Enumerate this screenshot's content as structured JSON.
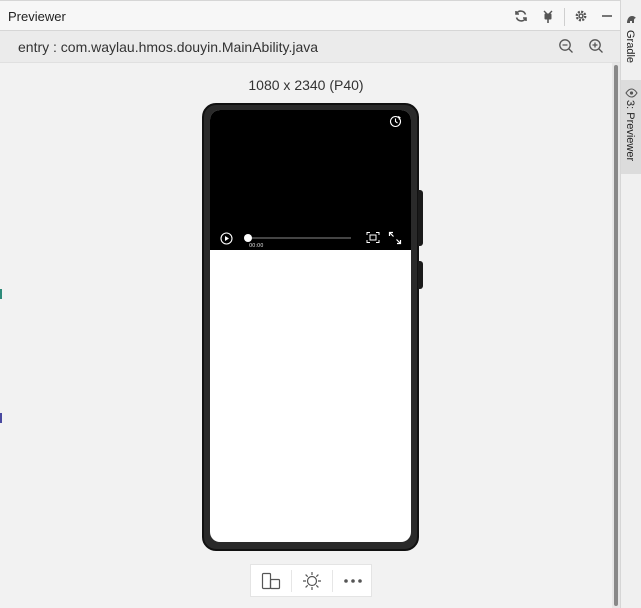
{
  "window": {
    "title": "Previewer"
  },
  "toolbar": {
    "refresh_icon": "refresh-icon",
    "debug_icon": "debug-icon",
    "settings_icon": "gear-icon",
    "minimize_icon": "minimize-icon"
  },
  "file": {
    "name": "entry : com.waylau.hmos.douyin.MainAbility.java",
    "zoom_out_icon": "zoom-out-icon",
    "zoom_in_icon": "zoom-in-icon"
  },
  "device": {
    "label": "1080 x 2340 (P40)"
  },
  "video_player": {
    "time": "00:00",
    "progress": 0,
    "rotate_icon": "rotate-icon",
    "play_icon": "play-icon",
    "pip_icon": "picture-in-picture-icon",
    "fullscreen_icon": "fullscreen-icon"
  },
  "bottom_toolbar": {
    "items": [
      {
        "icon": "multi-device-icon"
      },
      {
        "icon": "brightness-icon"
      },
      {
        "icon": "more-icon"
      }
    ]
  },
  "right_strip": {
    "tabs": [
      {
        "label": "Gradle",
        "icon": "gradle-icon"
      },
      {
        "label": "3: Previewer",
        "icon": "eye-icon"
      }
    ]
  },
  "colors": {
    "phone_body": "#2a2a2a",
    "video_bg": "#000000",
    "screen_bg": "#ffffff",
    "panel_bg": "#f2f2f2"
  }
}
